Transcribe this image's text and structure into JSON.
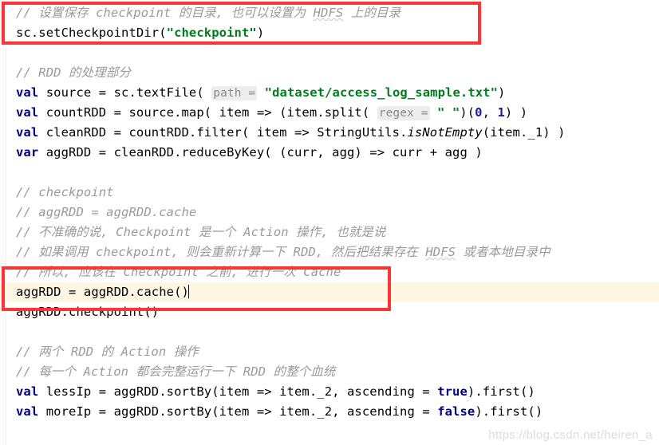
{
  "editor": {
    "language": "scala",
    "background_color": "#ffffff",
    "highlight_line_color": "#fdf6e3",
    "annotation_color": "#f93535",
    "comment_color": "#9a9a9a",
    "keyword_color": "#000080",
    "string_color": "#007d1c",
    "number_color": "#1a1aa6",
    "hint_chip_color": "#ededed"
  },
  "lines": [
    {
      "n": 1,
      "type": "comment",
      "text": "// 设置保存 checkpoint 的目录, 也可以设置为 HDFS 上的目录",
      "seg": {
        "a": "// 设置保存 checkpoint 的目录, 也可以设置为 ",
        "spell": "HDFS",
        "b": " 上的目录"
      }
    },
    {
      "n": 2,
      "type": "code",
      "text": "sc.setCheckpointDir(\"checkpoint\")",
      "seg": {
        "a": "sc.setCheckpointDir(",
        "str": "\"checkpoint\"",
        "b": ")"
      }
    },
    {
      "n": 3,
      "type": "blank",
      "text": ""
    },
    {
      "n": 4,
      "type": "comment",
      "text": "// RDD 的处理部分"
    },
    {
      "n": 5,
      "type": "code",
      "text": "val source = sc.textFile( path = \"dataset/access_log_sample.txt\")",
      "seg": {
        "kw": "val",
        "a": " source = sc.textFile( ",
        "hint": "path =",
        "b": " ",
        "str": "\"dataset/access_log_sample.txt\"",
        "c": ")"
      }
    },
    {
      "n": 6,
      "type": "code",
      "text": "val countRDD = source.map( item => (item.split( regex = \" \")(0), 1) )",
      "seg": {
        "kw": "val",
        "a": " countRDD = source.map( item => (item.split( ",
        "hint": "regex =",
        "b": " ",
        "str": "\" \"",
        "c": ")(",
        "num1": "0",
        "d": ", ",
        "num2": "1",
        "e": ") )"
      }
    },
    {
      "n": 7,
      "type": "code",
      "text": "val cleanRDD = countRDD.filter( item => StringUtils.isNotEmpty(item._1) )",
      "seg": {
        "kw": "val",
        "a": " cleanRDD = countRDD.filter( item => StringUtils.",
        "ital": "isNotEmpty",
        "b": "(item._1) )"
      }
    },
    {
      "n": 8,
      "type": "code",
      "text": "var aggRDD = cleanRDD.reduceByKey( (curr, agg) => curr + agg )",
      "seg": {
        "kw": "var",
        "a": " aggRDD = cleanRDD.reduceByKey( (curr, agg) => curr + agg )"
      }
    },
    {
      "n": 9,
      "type": "blank",
      "text": ""
    },
    {
      "n": 10,
      "type": "comment",
      "text": "// checkpoint"
    },
    {
      "n": 11,
      "type": "comment",
      "text": "// aggRDD = aggRDD.cache"
    },
    {
      "n": 12,
      "type": "comment",
      "text": "// 不准确的说, Checkpoint 是一个 Action 操作, 也就是说"
    },
    {
      "n": 13,
      "type": "comment",
      "text": "// 如果调用 checkpoint, 则会重新计算一下 RDD, 然后把结果存在 HDFS 或者本地目录中",
      "seg": {
        "a": "// 如果调用 checkpoint, 则会重新计算一下 RDD, 然后把结果存在 ",
        "spell": "HDFS",
        "b": " 或者本地目录中"
      }
    },
    {
      "n": 14,
      "type": "comment",
      "text": "// 所以, 应该在 Checkpoint 之前, 进行一次 Cache"
    },
    {
      "n": 15,
      "type": "code",
      "highlighted": true,
      "caret": true,
      "text": "aggRDD = aggRDD.cache()",
      "seg": {
        "a": "aggRDD = aggRDD.cache()"
      }
    },
    {
      "n": 16,
      "type": "code",
      "text": "aggRDD.checkpoint()",
      "seg": {
        "a": "aggRDD.checkpoint()"
      }
    },
    {
      "n": 17,
      "type": "blank",
      "text": ""
    },
    {
      "n": 18,
      "type": "comment",
      "text": "// 两个 RDD 的 Action 操作"
    },
    {
      "n": 19,
      "type": "comment",
      "text": "// 每一个 Action 都会完整运行一下 RDD 的整个血统"
    },
    {
      "n": 20,
      "type": "code",
      "text": "val lessIp = aggRDD.sortBy(item => item._2, ascending = true).first()",
      "seg": {
        "kw": "val",
        "a": " lessIp = aggRDD.sortBy(item => item._2, ascending = ",
        "bool": "true",
        "b": ").first()"
      }
    },
    {
      "n": 21,
      "type": "code",
      "text": "val moreIp = aggRDD.sortBy(item => item._2, ascending = false).first()",
      "seg": {
        "kw": "val",
        "a": " moreIp = aggRDD.sortBy(item => item._2, ascending = ",
        "bool": "false",
        "b": ").first()"
      }
    }
  ],
  "annotations": [
    {
      "id": "redbox-top",
      "label": "checkpoint-dir-annotation"
    },
    {
      "id": "redbox-cache",
      "label": "cache-call-annotation"
    }
  ],
  "watermark": {
    "text": "https://blog.csdn.net/heiren_a"
  }
}
